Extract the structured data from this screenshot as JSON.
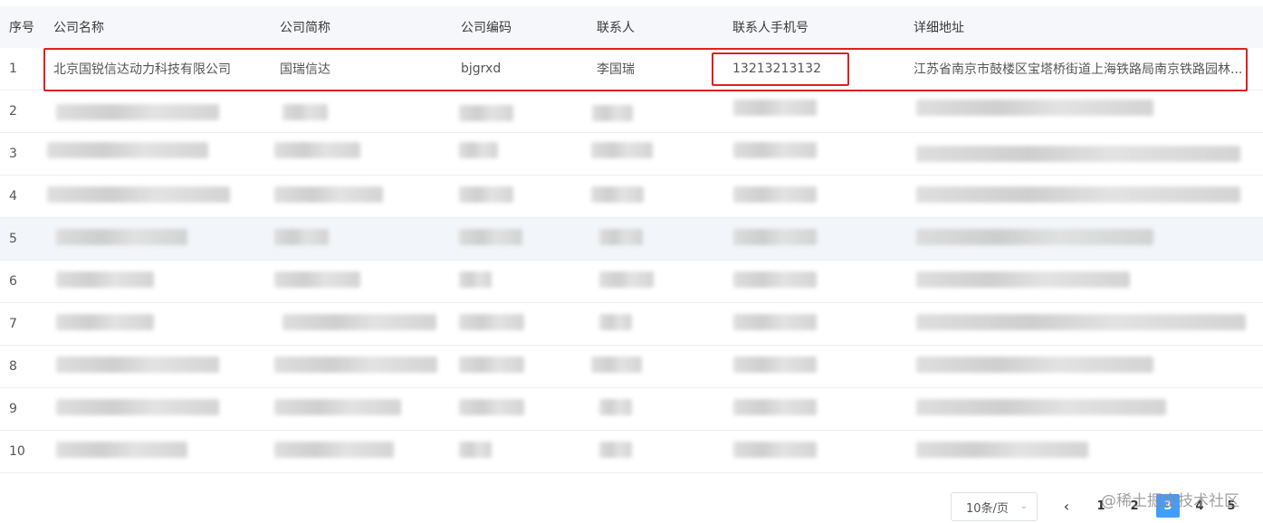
{
  "columns": [
    "序号",
    "公司名称",
    "公司简称",
    "公司编码",
    "联系人",
    "联系人手机号",
    "详细地址"
  ],
  "first_row": {
    "index": "1",
    "company_name": "北京国锐信达动力科技有限公司",
    "short_name": "国瑞信达",
    "code": "bjgrxd",
    "contact": "李国瑞",
    "phone": "13213213132",
    "address": "江苏省南京市鼓楼区宝塔桥街道上海铁路局南京铁路园林..."
  },
  "row_indices": [
    "2",
    "3",
    "4",
    "5",
    "6",
    "7",
    "8",
    "9",
    "10"
  ],
  "pagination": {
    "page_size": "10条/页",
    "prev": "‹",
    "pages": [
      "1",
      "2",
      "3",
      "4",
      "5"
    ],
    "active_page": "3"
  },
  "watermark": "@稀土掘金技术社区",
  "colors": {
    "accent": "#409eff",
    "highlight_border": "#e02020"
  }
}
